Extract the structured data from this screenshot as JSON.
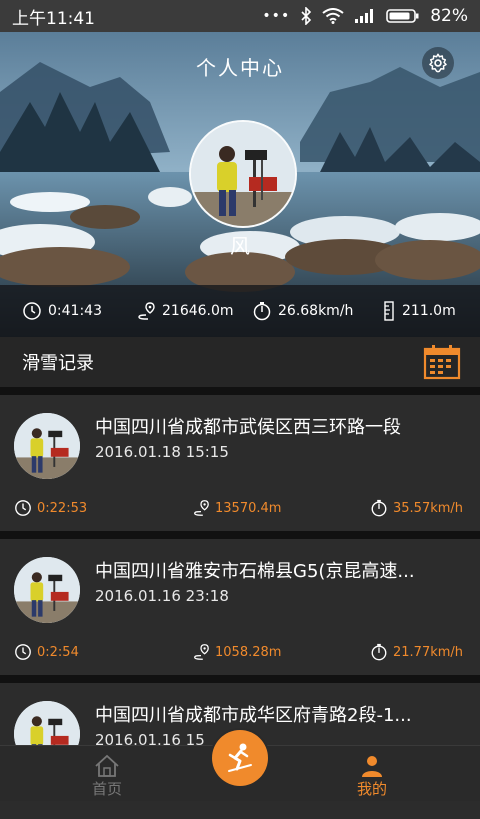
{
  "status_bar": {
    "time": "上午11:41",
    "battery": "82%"
  },
  "header": {
    "title": "个人中心",
    "username": "风",
    "stats": {
      "duration": "0:41:43",
      "distance": "21646.0m",
      "speed": "26.68km/h",
      "altitude": "211.0m"
    }
  },
  "section": {
    "title": "滑雪记录"
  },
  "records": [
    {
      "location": "中国四川省成都市武侯区西三环路一段",
      "datetime": "2016.01.18 15:15",
      "duration": "0:22:53",
      "distance": "13570.4m",
      "speed": "35.57km/h"
    },
    {
      "location": "中国四川省雅安市石棉县G5(京昆高速...",
      "datetime": "2016.01.16 23:18",
      "duration": "0:2:54",
      "distance": "1058.28m",
      "speed": "21.77km/h"
    },
    {
      "location": "中国四川省成都市成华区府青路2段-1...",
      "datetime": "2016.01.16 15"
    }
  ],
  "bottom_nav": {
    "home_label": "首页",
    "mine_label": "我的"
  },
  "colors": {
    "accent": "#f08a2c",
    "record_bg": "#2c2c2c",
    "statusbar_bg": "#3b3b3b"
  }
}
